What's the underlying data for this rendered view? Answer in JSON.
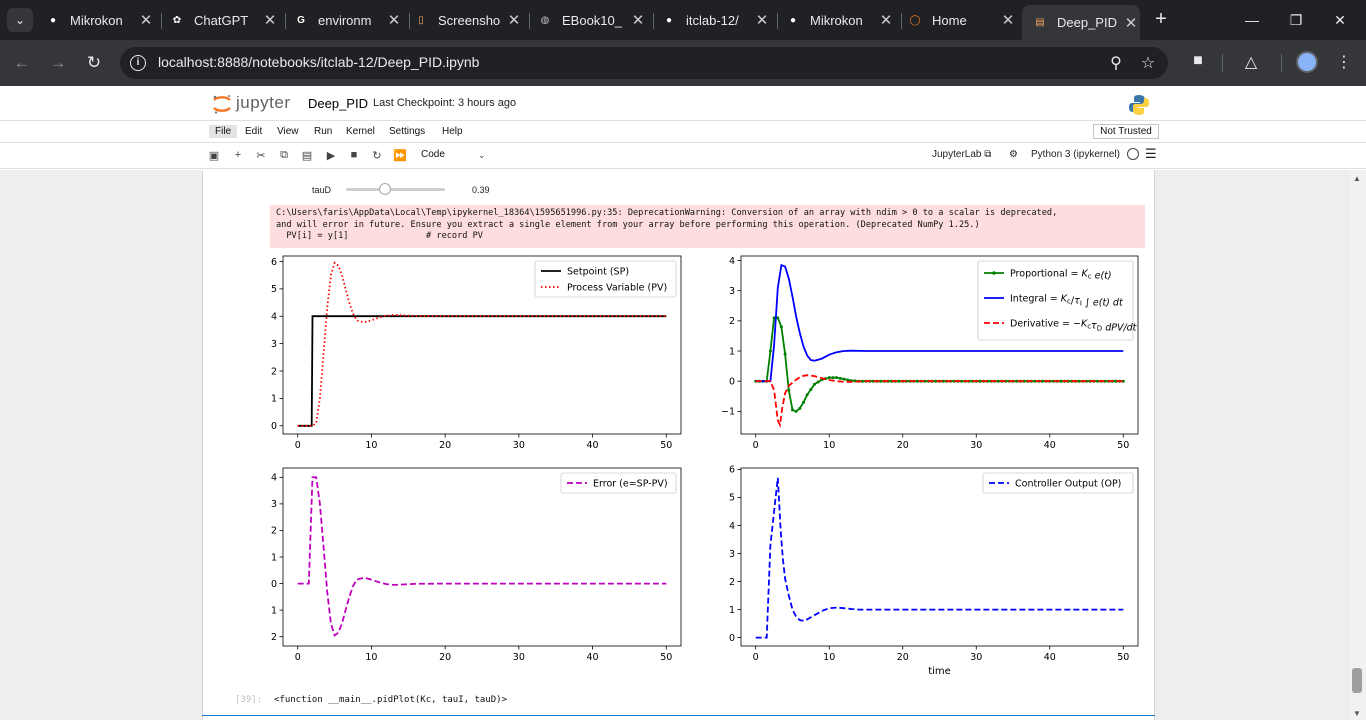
{
  "browser": {
    "tabs": [
      {
        "title": "Mikrokon",
        "icon": "github-icon",
        "active": false
      },
      {
        "title": "ChatGPT",
        "icon": "chatgpt-icon",
        "active": false
      },
      {
        "title": "environm",
        "icon": "google-icon",
        "active": false
      },
      {
        "title": "Screensho",
        "icon": "document-icon",
        "active": false
      },
      {
        "title": "EBook10_",
        "icon": "globe-icon",
        "active": false
      },
      {
        "title": "itclab-12/",
        "icon": "github-icon",
        "active": false
      },
      {
        "title": "Mikrokon",
        "icon": "github-icon",
        "active": false
      },
      {
        "title": "Home",
        "icon": "jupyter-icon",
        "active": false
      },
      {
        "title": "Deep_PID",
        "icon": "notebook-icon",
        "active": true
      }
    ],
    "url_host": "localhost",
    "url_rest": ":8888/notebooks/itclab-12/Deep_PID.ipynb"
  },
  "jupyter": {
    "logo_text": "jupyter",
    "notebook_name": "Deep_PID",
    "checkpoint": "Last Checkpoint: 3 hours ago",
    "menu": [
      "File",
      "Edit",
      "View",
      "Run",
      "Kernel",
      "Settings",
      "Help"
    ],
    "trust": "Not Trusted",
    "cell_type": "Code",
    "jupyterlab_link": "JupyterLab",
    "kernel_name": "Python 3 (ipykernel)"
  },
  "cell": {
    "slider_label": "tauD",
    "slider_value": "0.39",
    "slider_fraction": 0.39,
    "stderr_lines": [
      "C:\\Users\\faris\\AppData\\Local\\Temp\\ipykernel_18364\\1595651996.py:35: DeprecationWarning: Conversion of an array with ndim > 0 to a scalar is deprecated,",
      "and will error in future. Ensure you extract a single element from your array before performing this operation. (Deprecated NumPy 1.25.)",
      "  PV[i] = y[1]               # record PV"
    ],
    "out_prompt": "[39]:",
    "out_text": "<function __main__.pidPlot(Kc, tauI, tauD)>"
  },
  "colors": {
    "setpoint": "#000000",
    "pv": "#ff0000",
    "proportional": "#008000",
    "integral": "#0000ff",
    "derivative": "#ff0000",
    "error": "#bf00bf",
    "op": "#0000ff"
  },
  "chart_data": [
    {
      "type": "line",
      "xlim": [
        -2,
        52
      ],
      "ylim": [
        -0.3,
        6.2
      ],
      "xticks": [
        0,
        10,
        20,
        30,
        40,
        50
      ],
      "yticks": [
        0,
        1,
        2,
        3,
        4,
        5,
        6
      ],
      "legend": "upper right",
      "series": [
        {
          "name": "Setpoint (SP)",
          "style": "solid",
          "color": "#000000",
          "x": [
            0,
            1.9,
            2,
            50
          ],
          "y": [
            0,
            0,
            4,
            4
          ]
        },
        {
          "name": "Process Variable (PV)",
          "style": "dotted",
          "color": "#ff0000",
          "x": [
            0,
            2,
            2.5,
            3,
            3.5,
            4,
            4.5,
            5,
            5.5,
            6,
            6.5,
            7,
            7.5,
            8,
            9,
            10,
            11,
            12,
            13,
            14,
            16,
            20,
            30,
            40,
            50
          ],
          "y": [
            0,
            0,
            0.1,
            1.0,
            2.6,
            4.3,
            5.5,
            5.95,
            5.85,
            5.5,
            5.0,
            4.5,
            4.1,
            3.85,
            3.78,
            3.85,
            3.95,
            4.02,
            4.05,
            4.04,
            4.01,
            4.0,
            4.0,
            4.0,
            4.0
          ]
        }
      ]
    },
    {
      "type": "line",
      "xlim": [
        -2,
        52
      ],
      "ylim": [
        -1.75,
        4.15
      ],
      "xticks": [
        0,
        10,
        20,
        30,
        40,
        50
      ],
      "yticks": [
        -1,
        0,
        1,
        2,
        3,
        4
      ],
      "legend": "upper right",
      "series": [
        {
          "name": "Proportional",
          "style": "solid-marker",
          "color": "#008000",
          "x": [
            0,
            1.5,
            2,
            2.5,
            3,
            3.5,
            4,
            4.5,
            5,
            5.5,
            6,
            6.5,
            7,
            8,
            9,
            10,
            11,
            12,
            13,
            14,
            16,
            20,
            30,
            40,
            50
          ],
          "y": [
            0,
            0,
            1.0,
            2.1,
            2.1,
            1.8,
            0.9,
            -0.3,
            -0.95,
            -1.0,
            -0.9,
            -0.7,
            -0.45,
            -0.1,
            0.05,
            0.12,
            0.12,
            0.07,
            0.02,
            0,
            0,
            0,
            0,
            0,
            0
          ]
        },
        {
          "name": "Integral",
          "style": "solid",
          "color": "#0000ff",
          "x": [
            0,
            2,
            2.5,
            3,
            3.5,
            4,
            4.5,
            5,
            5.5,
            6,
            6.5,
            7,
            7.5,
            8,
            9,
            10,
            11,
            12,
            13,
            15,
            20,
            30,
            40,
            50
          ],
          "y": [
            0,
            0,
            1.2,
            3.1,
            3.85,
            3.8,
            3.4,
            2.8,
            2.15,
            1.6,
            1.15,
            0.85,
            0.7,
            0.68,
            0.75,
            0.88,
            0.96,
            1.0,
            1.01,
            1.0,
            1.0,
            1.0,
            1.0,
            1.0
          ]
        },
        {
          "name": "Derivative",
          "style": "dashed",
          "color": "#ff0000",
          "x": [
            0,
            2,
            2.5,
            3,
            3.3,
            3.6,
            4,
            4.5,
            5,
            5.5,
            6,
            6.5,
            7,
            8,
            9,
            10,
            11,
            12,
            13,
            15,
            20,
            30,
            40,
            50
          ],
          "y": [
            0,
            0,
            -0.3,
            -1.3,
            -1.45,
            -0.9,
            -0.4,
            -0.15,
            -0.05,
            0.05,
            0.13,
            0.18,
            0.2,
            0.17,
            0.1,
            0.04,
            0,
            -0.02,
            -0.02,
            0,
            0,
            0,
            0,
            0
          ]
        }
      ]
    },
    {
      "type": "line",
      "xlim": [
        -2,
        52
      ],
      "ylim": [
        -2.35,
        4.35
      ],
      "xticks": [
        0,
        10,
        20,
        30,
        40,
        50
      ],
      "yticks": [
        -2,
        -1,
        0,
        1,
        2,
        3,
        4
      ],
      "legend": "upper right",
      "series": [
        {
          "name": "Error (e=SP-PV)",
          "style": "dashed",
          "color": "#bf00bf",
          "x": [
            0,
            1.5,
            2,
            2.5,
            3,
            3.5,
            4,
            4.5,
            5,
            5.5,
            6,
            6.5,
            7,
            7.5,
            8,
            9,
            10,
            11,
            12,
            13,
            14,
            16,
            20,
            30,
            40,
            50
          ],
          "y": [
            0,
            0,
            4.0,
            4.0,
            3.0,
            1.4,
            -0.3,
            -1.5,
            -1.95,
            -1.85,
            -1.5,
            -1.0,
            -0.5,
            -0.1,
            0.15,
            0.22,
            0.15,
            0.05,
            -0.02,
            -0.05,
            -0.04,
            -0.01,
            0,
            0,
            0,
            0
          ]
        }
      ]
    },
    {
      "type": "line",
      "xlabel": "time",
      "xlim": [
        -2,
        52
      ],
      "ylim": [
        -0.3,
        6.05
      ],
      "xticks": [
        0,
        10,
        20,
        30,
        40,
        50
      ],
      "yticks": [
        0,
        1,
        2,
        3,
        4,
        5,
        6
      ],
      "legend": "upper right",
      "series": [
        {
          "name": "Controller Output (OP)",
          "style": "dashed",
          "color": "#0000ff",
          "x": [
            0,
            1.5,
            2,
            2.5,
            3,
            3.4,
            3.7,
            4,
            4.5,
            5,
            5.5,
            6,
            6.5,
            7,
            8,
            9,
            10,
            11,
            12,
            13,
            14,
            16,
            20,
            30,
            40,
            50
          ],
          "y": [
            0,
            0,
            3.3,
            4.5,
            5.7,
            3.8,
            2.8,
            2.1,
            1.5,
            1.0,
            0.75,
            0.62,
            0.6,
            0.65,
            0.8,
            0.95,
            1.05,
            1.07,
            1.05,
            1.02,
            1.0,
            1.0,
            1.0,
            1.0,
            1.0,
            1.0
          ]
        }
      ]
    }
  ]
}
